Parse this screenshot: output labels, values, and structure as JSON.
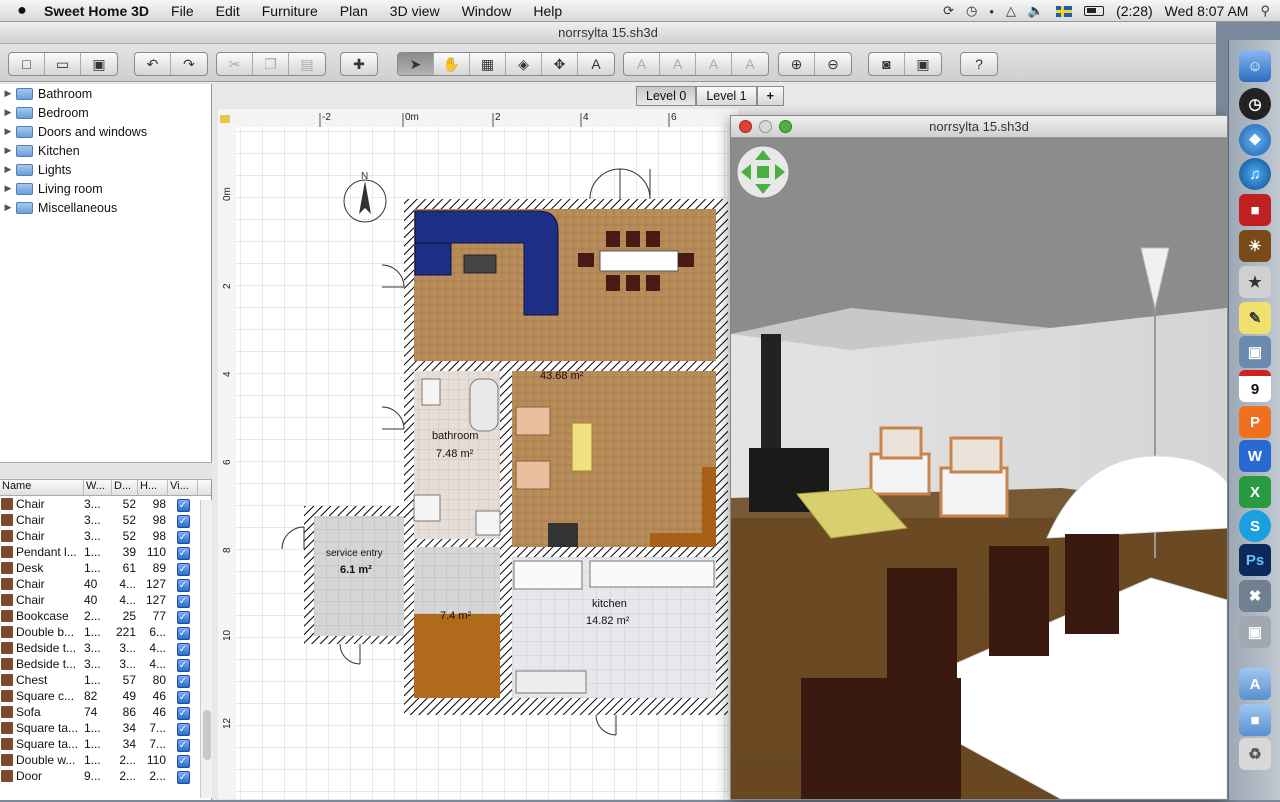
{
  "menubar": {
    "apple": "",
    "app_name": "Sweet Home 3D",
    "items": [
      "File",
      "Edit",
      "Furniture",
      "Plan",
      "3D view",
      "Window",
      "Help"
    ],
    "battery_time": "(2:28)",
    "clock": "Wed 8:07 AM"
  },
  "window": {
    "title": "norrsylta 15.sh3d"
  },
  "toolbar": {
    "groups": [
      [
        "new-home-icon",
        "open-icon",
        "save-icon"
      ],
      [
        "undo-icon",
        "redo-icon"
      ],
      [
        "cut-icon",
        "copy-icon",
        "paste-icon"
      ],
      [
        "add-furniture-icon"
      ],
      [
        "select-icon",
        "pan-icon",
        "create-walls-icon",
        "create-rooms-icon",
        "create-dimensions-icon",
        "add-text-icon"
      ],
      [
        "increase-text-icon",
        "decrease-text-icon",
        "bold-text-icon",
        "italic-text-icon"
      ],
      [
        "zoom-in-icon",
        "zoom-out-icon"
      ],
      [
        "create-photo-icon",
        "create-video-icon"
      ],
      [
        "help-icon"
      ]
    ]
  },
  "catalog": {
    "categories": [
      "Bathroom",
      "Bedroom",
      "Doors and windows",
      "Kitchen",
      "Lights",
      "Living room",
      "Miscellaneous"
    ]
  },
  "furniture_table": {
    "headers": [
      "Name",
      "W...",
      "D...",
      "H...",
      "Vi..."
    ],
    "rows": [
      {
        "name": "Chair",
        "w": "3...",
        "d": "52",
        "h": "98"
      },
      {
        "name": "Chair",
        "w": "3...",
        "d": "52",
        "h": "98"
      },
      {
        "name": "Chair",
        "w": "3...",
        "d": "52",
        "h": "98"
      },
      {
        "name": "Pendant l...",
        "w": "1...",
        "d": "39",
        "h": "110"
      },
      {
        "name": "Desk",
        "w": "1...",
        "d": "61",
        "h": "89"
      },
      {
        "name": "Chair",
        "w": "40",
        "d": "4...",
        "h": "127"
      },
      {
        "name": "Chair",
        "w": "40",
        "d": "4...",
        "h": "127"
      },
      {
        "name": "Bookcase",
        "w": "2...",
        "d": "25",
        "h": "77"
      },
      {
        "name": "Double b...",
        "w": "1...",
        "d": "221",
        "h": "6..."
      },
      {
        "name": "Bedside t...",
        "w": "3...",
        "d": "3...",
        "h": "4..."
      },
      {
        "name": "Bedside t...",
        "w": "3...",
        "d": "3...",
        "h": "4..."
      },
      {
        "name": "Chest",
        "w": "1...",
        "d": "57",
        "h": "80"
      },
      {
        "name": "Square c...",
        "w": "82",
        "d": "49",
        "h": "46"
      },
      {
        "name": "Sofa",
        "w": "74",
        "d": "86",
        "h": "46"
      },
      {
        "name": "Square ta...",
        "w": "1...",
        "d": "34",
        "h": "7..."
      },
      {
        "name": "Square ta...",
        "w": "1...",
        "d": "34",
        "h": "7..."
      },
      {
        "name": "Double w...",
        "w": "1...",
        "d": "2...",
        "h": "110"
      },
      {
        "name": "Door",
        "w": "9...",
        "d": "2...",
        "h": "2..."
      }
    ]
  },
  "plan": {
    "levels": [
      "Level 0",
      "Level 1"
    ],
    "add_level": "+",
    "ruler_h": [
      "-2",
      "0m",
      "2",
      "4",
      "6"
    ],
    "ruler_v": [
      "0m",
      "2",
      "4",
      "6",
      "8",
      "10",
      "12"
    ],
    "compass": "N",
    "rooms": [
      {
        "name": "",
        "area": "43.68 m²"
      },
      {
        "name": "bathroom",
        "area": "7.48 m²"
      },
      {
        "name": "service entry",
        "area": "6.1 m²"
      },
      {
        "name": "",
        "area": "7.4 m²"
      },
      {
        "name": "kitchen",
        "area": "14.82 m²"
      }
    ]
  },
  "view3d": {
    "title": "norrsylta 15.sh3d"
  },
  "dock": {
    "calendar_day": "9",
    "ps_label": "Ps"
  }
}
